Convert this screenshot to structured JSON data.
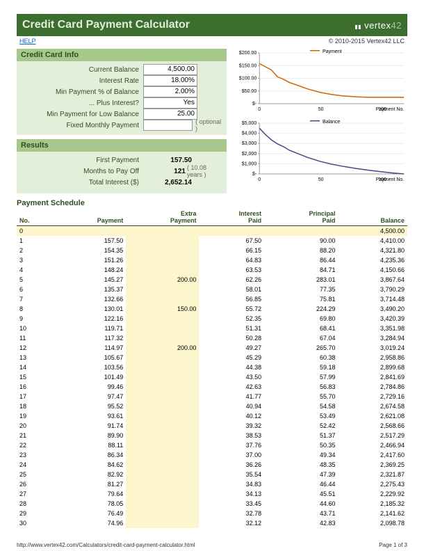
{
  "header": {
    "title": "Credit Card Payment Calculator",
    "logo_text": "vertex",
    "logo_num": "42",
    "help": "HELP",
    "copyright": "© 2010-2015 Vertex42 LLC"
  },
  "info": {
    "section": "Credit Card Info",
    "labels": {
      "balance": "Current Balance",
      "rate": "Interest Rate",
      "minpct": "Min Payment % of Balance",
      "plusint": "... Plus Interest?",
      "minlow": "Min Payment for Low Balance",
      "fixed": "Fixed Monthly Payment"
    },
    "values": {
      "balance": "4,500.00",
      "rate": "18.00%",
      "minpct": "2.00%",
      "plusint": "Yes",
      "minlow": "25.00",
      "fixed": ""
    },
    "optional": "( optional )"
  },
  "results": {
    "section": "Results",
    "labels": {
      "first": "First Payment",
      "months": "Months to Pay Off",
      "interest": "Total Interest ($)"
    },
    "values": {
      "first": "157.50",
      "months": "121",
      "years": "( 10.08 years )",
      "interest": "2,652.14"
    }
  },
  "chart_data": [
    {
      "type": "line",
      "title": "Payment",
      "legend": "Payment",
      "xlabel": "Payment No.",
      "ylabel": "",
      "ylim": [
        0,
        200
      ],
      "yticks": [
        "$-",
        "$50.00",
        "$100.00",
        "$150.00",
        "$200.00"
      ],
      "xticks": [
        "0",
        "50",
        "100"
      ],
      "x": [
        0,
        5,
        10,
        15,
        20,
        25,
        30,
        40,
        50,
        60,
        70,
        80,
        90,
        100,
        110,
        120
      ],
      "values": [
        157.5,
        145.3,
        132.7,
        105.7,
        95.5,
        82.9,
        75.0,
        58,
        45,
        36,
        30,
        27,
        25,
        25,
        25,
        25
      ],
      "color": "#cc6600"
    },
    {
      "type": "line",
      "title": "Balance",
      "legend": "Balance",
      "xlabel": "Payment No.",
      "ylabel": "",
      "ylim": [
        0,
        5000
      ],
      "yticks": [
        "$-",
        "$1,000",
        "$2,000",
        "$3,000",
        "$4,000",
        "$5,000"
      ],
      "xticks": [
        "0",
        "50",
        "100"
      ],
      "x": [
        0,
        5,
        10,
        15,
        20,
        25,
        30,
        40,
        50,
        60,
        70,
        80,
        90,
        100,
        110,
        120
      ],
      "values": [
        4500,
        3868,
        3352,
        2959,
        2675,
        2322,
        2099,
        1620,
        1250,
        960,
        730,
        540,
        380,
        230,
        100,
        0
      ],
      "color": "#5b3d8a"
    }
  ],
  "schedule": {
    "title": "Payment Schedule",
    "headers": {
      "no": "No.",
      "payment": "Payment",
      "extra": "Extra\nPayment",
      "interest": "Interest\nPaid",
      "principal": "Principal\nPaid",
      "balance": "Balance"
    },
    "rows": [
      {
        "no": "0",
        "payment": "",
        "extra": "",
        "interest": "",
        "principal": "",
        "balance": "4,500.00"
      },
      {
        "no": "1",
        "payment": "157.50",
        "extra": "",
        "interest": "67.50",
        "principal": "90.00",
        "balance": "4,410.00"
      },
      {
        "no": "2",
        "payment": "154.35",
        "extra": "",
        "interest": "66.15",
        "principal": "88.20",
        "balance": "4,321.80"
      },
      {
        "no": "3",
        "payment": "151.26",
        "extra": "",
        "interest": "64.83",
        "principal": "86.44",
        "balance": "4,235.36"
      },
      {
        "no": "4",
        "payment": "148.24",
        "extra": "",
        "interest": "63.53",
        "principal": "84.71",
        "balance": "4,150.66"
      },
      {
        "no": "5",
        "payment": "145.27",
        "extra": "200.00",
        "interest": "62.26",
        "principal": "283.01",
        "balance": "3,867.64"
      },
      {
        "no": "6",
        "payment": "135.37",
        "extra": "",
        "interest": "58.01",
        "principal": "77.35",
        "balance": "3,790.29"
      },
      {
        "no": "7",
        "payment": "132.66",
        "extra": "",
        "interest": "56.85",
        "principal": "75.81",
        "balance": "3,714.48"
      },
      {
        "no": "8",
        "payment": "130.01",
        "extra": "150.00",
        "interest": "55.72",
        "principal": "224.29",
        "balance": "3,490.20"
      },
      {
        "no": "9",
        "payment": "122.16",
        "extra": "",
        "interest": "52.35",
        "principal": "69.80",
        "balance": "3,420.39"
      },
      {
        "no": "10",
        "payment": "119.71",
        "extra": "",
        "interest": "51.31",
        "principal": "68.41",
        "balance": "3,351.98"
      },
      {
        "no": "11",
        "payment": "117.32",
        "extra": "",
        "interest": "50.28",
        "principal": "67.04",
        "balance": "3,284.94"
      },
      {
        "no": "12",
        "payment": "114.97",
        "extra": "200.00",
        "interest": "49.27",
        "principal": "265.70",
        "balance": "3,019.24"
      },
      {
        "no": "13",
        "payment": "105.67",
        "extra": "",
        "interest": "45.29",
        "principal": "60.38",
        "balance": "2,958.86"
      },
      {
        "no": "14",
        "payment": "103.56",
        "extra": "",
        "interest": "44.38",
        "principal": "59.18",
        "balance": "2,899.68"
      },
      {
        "no": "15",
        "payment": "101.49",
        "extra": "",
        "interest": "43.50",
        "principal": "57.99",
        "balance": "2,841.69"
      },
      {
        "no": "16",
        "payment": "99.46",
        "extra": "",
        "interest": "42.63",
        "principal": "56.83",
        "balance": "2,784.86"
      },
      {
        "no": "17",
        "payment": "97.47",
        "extra": "",
        "interest": "41.77",
        "principal": "55.70",
        "balance": "2,729.16"
      },
      {
        "no": "18",
        "payment": "95.52",
        "extra": "",
        "interest": "40.94",
        "principal": "54.58",
        "balance": "2,674.58"
      },
      {
        "no": "19",
        "payment": "93.61",
        "extra": "",
        "interest": "40.12",
        "principal": "53.49",
        "balance": "2,621.08"
      },
      {
        "no": "20",
        "payment": "91.74",
        "extra": "",
        "interest": "39.32",
        "principal": "52.42",
        "balance": "2,568.66"
      },
      {
        "no": "21",
        "payment": "89.90",
        "extra": "",
        "interest": "38.53",
        "principal": "51.37",
        "balance": "2,517.29"
      },
      {
        "no": "22",
        "payment": "88.11",
        "extra": "",
        "interest": "37.76",
        "principal": "50.35",
        "balance": "2,466.94"
      },
      {
        "no": "23",
        "payment": "86.34",
        "extra": "",
        "interest": "37.00",
        "principal": "49.34",
        "balance": "2,417.60"
      },
      {
        "no": "24",
        "payment": "84.62",
        "extra": "",
        "interest": "36.26",
        "principal": "48.35",
        "balance": "2,369.25"
      },
      {
        "no": "25",
        "payment": "82.92",
        "extra": "",
        "interest": "35.54",
        "principal": "47.39",
        "balance": "2,321.87"
      },
      {
        "no": "26",
        "payment": "81.27",
        "extra": "",
        "interest": "34.83",
        "principal": "46.44",
        "balance": "2,275.43"
      },
      {
        "no": "27",
        "payment": "79.64",
        "extra": "",
        "interest": "34.13",
        "principal": "45.51",
        "balance": "2,229.92"
      },
      {
        "no": "28",
        "payment": "78.05",
        "extra": "",
        "interest": "33.45",
        "principal": "44.60",
        "balance": "2,185.32"
      },
      {
        "no": "29",
        "payment": "76.49",
        "extra": "",
        "interest": "32.78",
        "principal": "43.71",
        "balance": "2,141.62"
      },
      {
        "no": "30",
        "payment": "74.96",
        "extra": "",
        "interest": "32.12",
        "principal": "42.83",
        "balance": "2,098.78"
      }
    ]
  },
  "footer": {
    "url": "http://www.vertex42.com/Calculators/credit-card-payment-calculator.html",
    "page": "Page 1 of 3"
  }
}
